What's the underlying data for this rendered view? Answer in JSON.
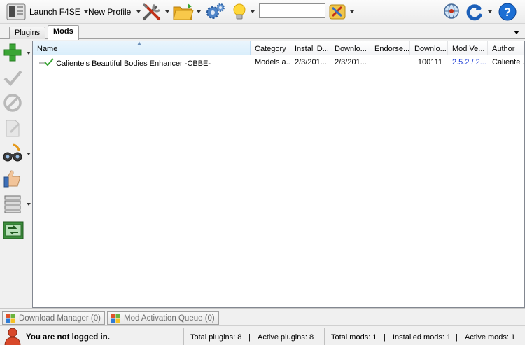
{
  "toolbar": {
    "launch_label": "Launch F4SE",
    "profile_label": "New Profile",
    "search_value": ""
  },
  "tabs": [
    {
      "label": "Plugins"
    },
    {
      "label": "Mods"
    }
  ],
  "grid": {
    "columns": [
      "Name",
      "Category",
      "Install D...",
      "Downlo...",
      "Endorse...",
      "Downlo...",
      "Mod Ve...",
      "Author"
    ],
    "rows": [
      {
        "name": "Caliente's Beautiful Bodies Enhancer -CBBE-",
        "category": "Models a...",
        "install_date": "2/3/201...",
        "download_date": "2/3/201...",
        "endorsement": "",
        "download_id": "100111",
        "mod_version": "2.5.2 / 2...",
        "author": "Caliente ..."
      }
    ]
  },
  "bottom_tabs": {
    "download_manager": "Download Manager (0)",
    "activation_queue": "Mod Activation Queue (0)"
  },
  "status": {
    "login": "You are not logged in.",
    "total_plugins": "Total plugins: 8",
    "active_plugins": "Active plugins:  8",
    "total_mods": "Total mods: 1",
    "installed_mods": "Installed mods: 1",
    "active_mods": "Active mods: 1",
    "sep": "|"
  },
  "colors": {
    "accent_green": "#3aa535",
    "link_blue": "#1f3fd6",
    "help_blue": "#1c6fd4"
  }
}
